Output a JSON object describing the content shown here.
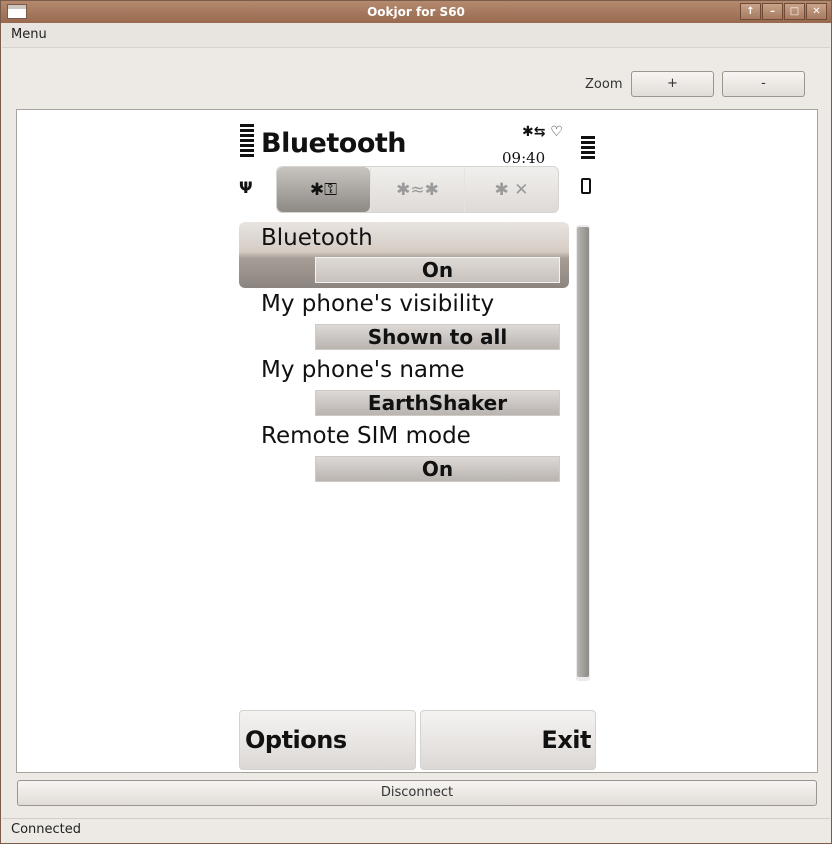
{
  "window": {
    "title": "Ookjor for S60",
    "controls": [
      "↑",
      "–",
      "□",
      "✕"
    ]
  },
  "menubar": {
    "menu_label": "Menu"
  },
  "zoom": {
    "label": "Zoom",
    "plus_label": "+",
    "minus_label": "-"
  },
  "phone": {
    "title": "Bluetooth",
    "clock": "09:40",
    "status_icons": "✱⇆ ♡",
    "antenna": "Ψ",
    "tabs": [
      {
        "icon": "✱⚿",
        "name": "settings-tab-icon"
      },
      {
        "icon": "✱≈✱",
        "name": "paired-devices-tab-icon"
      },
      {
        "icon": "✱ ✕",
        "name": "blocked-devices-tab-icon"
      }
    ],
    "settings": [
      {
        "label": "Bluetooth",
        "value": "On"
      },
      {
        "label": "My phone's visibility",
        "value": "Shown to all"
      },
      {
        "label": "My phone's name",
        "value": "EarthShaker"
      },
      {
        "label": "Remote SIM mode",
        "value": "On"
      }
    ],
    "softkeys": {
      "left": "Options",
      "right": "Exit"
    }
  },
  "disconnect_label": "Disconnect",
  "status_text": "Connected",
  "colors": {
    "titlebar": "#a67a5e",
    "highlight": "#a69d96"
  }
}
